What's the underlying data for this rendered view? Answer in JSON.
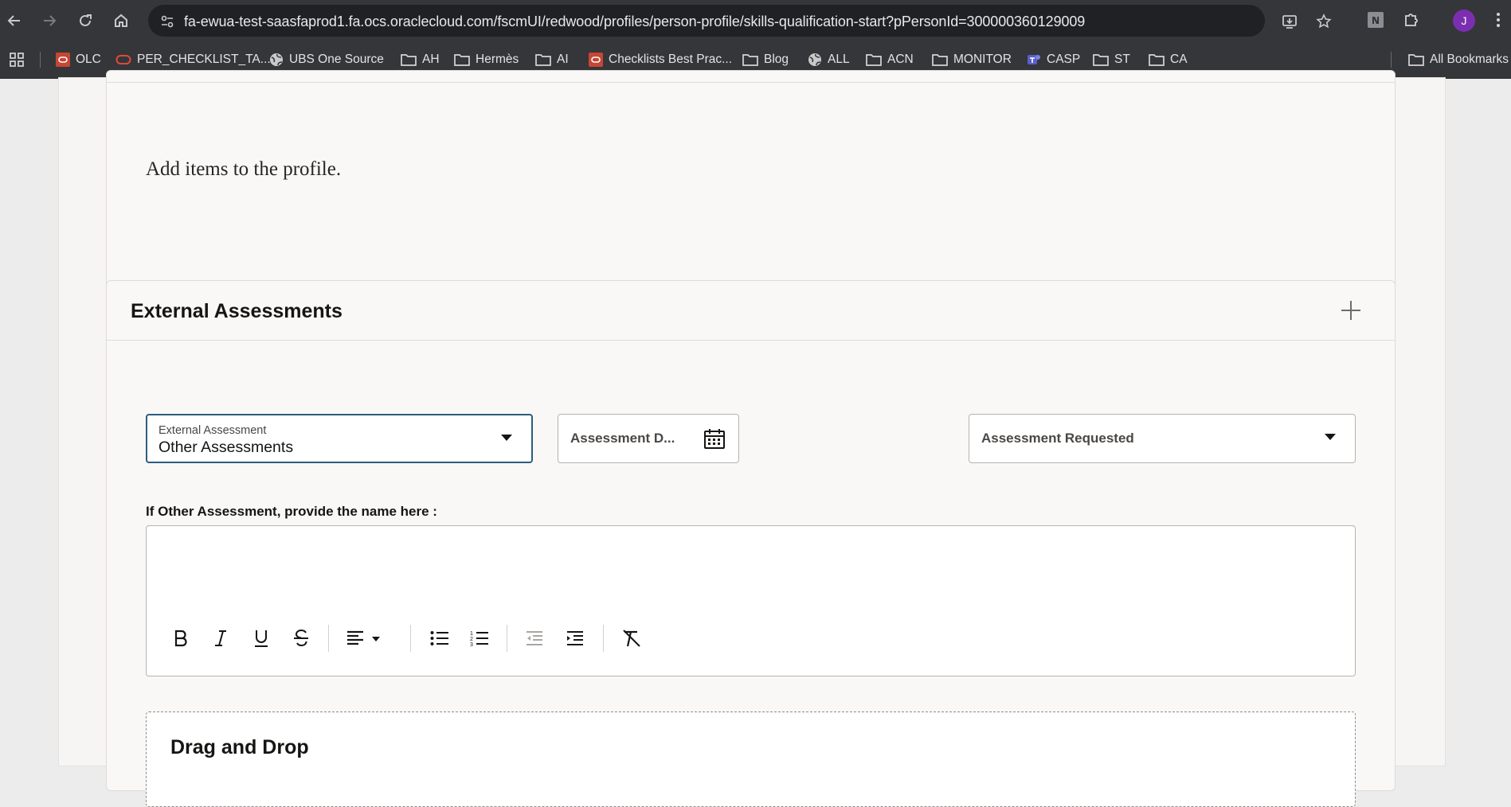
{
  "browser": {
    "url": "fa-ewua-test-saasfaprod1.fa.ocs.oraclecloud.com/fscmUI/redwood/profiles/person-profile/skills-qualification-start?pPersonId=300000360129009",
    "avatar_letter": "J",
    "bookmarks": [
      {
        "label": "OLC",
        "icon": "oracle-square-icon"
      },
      {
        "label": "PER_CHECKLIST_TA...",
        "icon": "oracle-ring-icon"
      },
      {
        "label": "UBS One Source",
        "icon": "globe-icon"
      },
      {
        "label": "AH",
        "icon": "folder-icon"
      },
      {
        "label": "Hermès",
        "icon": "folder-icon"
      },
      {
        "label": "AI",
        "icon": "folder-icon"
      },
      {
        "label": "Checklists Best Prac...",
        "icon": "oracle-square-icon"
      },
      {
        "label": "Blog",
        "icon": "folder-icon"
      },
      {
        "label": "ALL",
        "icon": "globe-icon"
      },
      {
        "label": "ACN",
        "icon": "folder-icon"
      },
      {
        "label": "MONITOR",
        "icon": "folder-icon"
      },
      {
        "label": "CASP",
        "icon": "teams-icon"
      },
      {
        "label": "ST",
        "icon": "folder-icon"
      },
      {
        "label": "CA",
        "icon": "folder-icon"
      }
    ],
    "all_bookmarks": "All Bookmarks"
  },
  "profile": {
    "empty_message": "Add items to the profile."
  },
  "external_assessments": {
    "title": "External Assessments",
    "assessment_field": {
      "label": "External Assessment",
      "value": "Other Assessments"
    },
    "date_field": {
      "placeholder": "Assessment D..."
    },
    "requested_field": {
      "placeholder": "Assessment Requested"
    },
    "other_name_label": "If Other Assessment, provide the name here :",
    "drag_drop_title": "Drag and Drop"
  },
  "colors": {
    "accent": "#2b5d7d",
    "browser_chrome": "#35363a",
    "avatar": "#7b2fb0"
  }
}
